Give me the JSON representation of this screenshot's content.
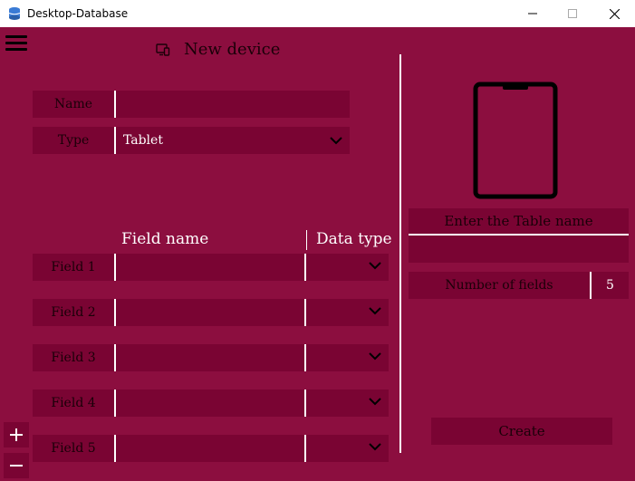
{
  "window": {
    "title": "Desktop-Database"
  },
  "header": {
    "title": "New device"
  },
  "form": {
    "name_label": "Name",
    "name_value": "",
    "type_label": "Type",
    "type_value": "Tablet"
  },
  "fields": {
    "col_field_name": "Field name",
    "col_data_type": "Data type",
    "rows": [
      {
        "label": "Field 1",
        "name": "",
        "type": ""
      },
      {
        "label": "Field 2",
        "name": "",
        "type": ""
      },
      {
        "label": "Field 3",
        "name": "",
        "type": ""
      },
      {
        "label": "Field 4",
        "name": "",
        "type": ""
      },
      {
        "label": "Field 5",
        "name": "",
        "type": ""
      }
    ]
  },
  "table": {
    "name_label": "Enter the Table name",
    "name_value": "",
    "num_fields_label": "Number of fields",
    "num_fields_value": "5"
  },
  "actions": {
    "create_label": "Create"
  },
  "icons": {
    "menu": "hamburger-menu-icon",
    "device": "device-icon",
    "preview": "tablet-icon",
    "add": "plus-icon",
    "remove": "minus-icon"
  },
  "colors": {
    "background": "#8c0e3f",
    "field": "#7a0433",
    "text_dark": "#1a0008",
    "text_light": "#ffffff"
  }
}
